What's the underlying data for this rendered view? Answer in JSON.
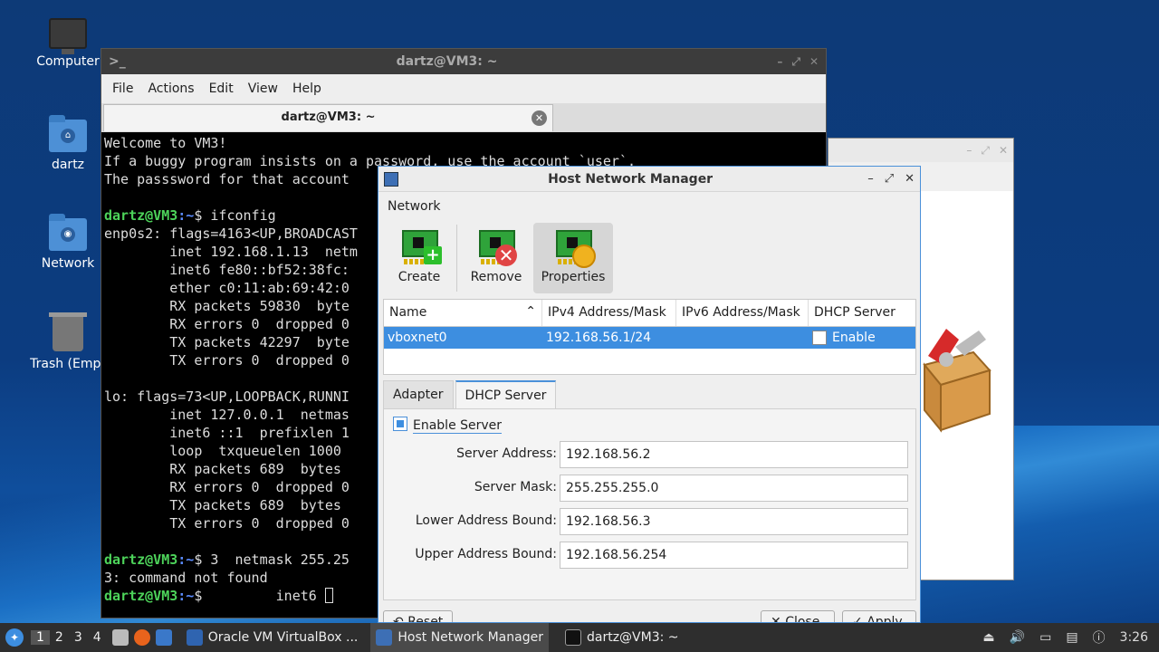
{
  "desktop": {
    "icons": [
      {
        "label": "Computer",
        "icon": "computer-icon"
      },
      {
        "label": "dartz",
        "icon": "home-folder-icon"
      },
      {
        "label": "Network",
        "icon": "network-folder-icon"
      },
      {
        "label": "Trash (Empt",
        "icon": "trash-icon"
      }
    ]
  },
  "terminal": {
    "title": "dartz@VM3: ~",
    "menu": [
      "File",
      "Actions",
      "Edit",
      "View",
      "Help"
    ],
    "tab_title": "dartz@VM3: ~",
    "lines": [
      "Welcome to VM3!",
      "If a buggy program insists on a password, use the account `user`.",
      "The passsword for that account",
      "",
      "enp0s2: flags=4163<UP,BROADCAST",
      "        inet 192.168.1.13  netm",
      "        inet6 fe80::bf52:38fc:",
      "        ether c0:11:ab:69:42:0",
      "        RX packets 59830  byte",
      "        RX errors 0  dropped 0",
      "        TX packets 42297  byte",
      "        TX errors 0  dropped 0",
      "",
      "lo: flags=73<UP,LOOPBACK,RUNNI",
      "        inet 127.0.0.1  netmas",
      "        inet6 ::1  prefixlen 1",
      "        loop  txqueuelen 1000",
      "        RX packets 689  bytes ",
      "        RX errors 0  dropped 0",
      "        TX packets 689  bytes ",
      "        TX errors 0  dropped 0",
      "",
      "3: command not found"
    ],
    "prompt_user": "dartz@VM3",
    "prompt_path": ":~",
    "prompt_symbol": "$",
    "cmd1": " ifconfig",
    "cmd2": " 3  netmask 255.25",
    "cmd3": "         inet6 "
  },
  "vbox": {
    "title_controls": [
      "–",
      "⤢",
      "✕"
    ]
  },
  "hnm": {
    "title": "Host Network Manager",
    "menu": "Network",
    "tools": [
      {
        "label": "Create",
        "icon": "create-nic-icon"
      },
      {
        "label": "Remove",
        "icon": "remove-nic-icon"
      },
      {
        "label": "Properties",
        "icon": "properties-nic-icon"
      }
    ],
    "columns": [
      "Name",
      "IPv4 Address/Mask",
      "IPv6 Address/Mask",
      "DHCP Server"
    ],
    "rows": [
      {
        "name": "vboxnet0",
        "ipv4": "192.168.56.1/24",
        "ipv6": "",
        "dhcp": "Enable"
      }
    ],
    "tabs": [
      "Adapter",
      "DHCP Server"
    ],
    "enable_server": "Enable Server",
    "fields": [
      {
        "label": "Server Address:",
        "value": "192.168.56.2"
      },
      {
        "label": "Server Mask:",
        "value": "255.255.255.0"
      },
      {
        "label": "Lower Address Bound:",
        "value": "192.168.56.3"
      },
      {
        "label": "Upper Address Bound:",
        "value": "192.168.56.254"
      }
    ],
    "reset_label": "Reset",
    "close_label": "Close",
    "apply_label": "Apply"
  },
  "taskbar": {
    "workspaces": [
      "1",
      "2",
      "3",
      "4"
    ],
    "tasks": [
      {
        "label": "Oracle VM VirtualBox ...",
        "icon": "virtualbox-icon"
      },
      {
        "label": "Host Network Manager",
        "icon": "network-manager-icon"
      },
      {
        "label": "dartz@VM3: ~",
        "icon": "terminal-icon"
      }
    ],
    "clock": "3:26"
  }
}
